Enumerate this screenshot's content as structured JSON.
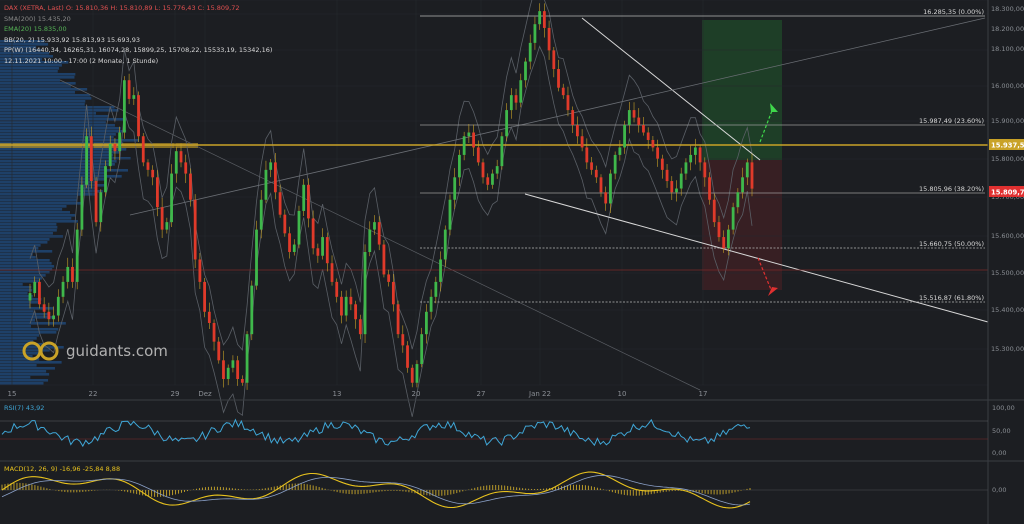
{
  "legend": {
    "title": "DAX (XETRA, Last)",
    "ohlc": "O: 15.810,36  H: 15.810,89  L: 15.776,43  C: 15.809,72",
    "sma200": "SMA(200)  15.435,20",
    "ema": "EMA(20)  15.835,00",
    "bb": "BB(20, 2)  15.933,92  15.813,93  15.693,93",
    "pp": "PP(W)  (16440,34, 16265,31, 16074,28, 15899,25, 15708,22, 15533,19, 15342,16)",
    "range": "12.11.2021 10:00 - 17:00  (2 Monate, 1 Stunde)"
  },
  "logo_text": "guidants.com",
  "rsi_label": "RSI(7)  43,92",
  "macd_label": "MACD(12, 26, 9)  -16,96  -25,84  8,88",
  "chart_data": {
    "type": "line",
    "title": "DAX (XETRA, Last)",
    "y_ticks": [
      "18.300,00",
      "18.200,00",
      "18.100,00",
      "16.000,00",
      "15.900,00",
      "15.800,00",
      "15.700,00",
      "15.600,00",
      "15.500,00",
      "15.400,00",
      "15.300,00"
    ],
    "x_ticks": [
      "15",
      "22",
      "29",
      "Dez",
      "13",
      "20",
      "27",
      "Jan 22",
      "10",
      "17"
    ],
    "fibonacci": [
      {
        "price": 16285.35,
        "label": "16.285,35 (0.00%)"
      },
      {
        "price": 15987.49,
        "label": "15.987,49 (23.60%)"
      },
      {
        "price": 15805.96,
        "label": "15.805,96 (38.20%)"
      },
      {
        "price": 15660.75,
        "label": "15.660,75 (50.00%)"
      },
      {
        "price": 15516.87,
        "label": "15.516,87 (61.80%)"
      }
    ],
    "price_tags": [
      {
        "price": 15937.5,
        "label": "15.937,50",
        "color": "#c9a227"
      },
      {
        "price": 15809.72,
        "label": "15.809,72",
        "color": "#e03030"
      }
    ],
    "ylim": [
      15270,
      16300
    ],
    "close_path": [
      15530,
      15560,
      15500,
      15480,
      15460,
      15470,
      15520,
      15560,
      15600,
      15560,
      15700,
      15820,
      15950,
      15830,
      15720,
      15800,
      15870,
      15930,
      15910,
      15960,
      16100,
      16050,
      16060,
      15950,
      15880,
      15860,
      15840,
      15760,
      15700,
      15720,
      15850,
      15910,
      15880,
      15850,
      15780,
      15620,
      15560,
      15480,
      15450,
      15400,
      15350,
      15300,
      15330,
      15350,
      15300,
      15290,
      15420,
      15550,
      15700,
      15780,
      15860,
      15880,
      15800,
      15740,
      15690,
      15640,
      15660,
      15750,
      15820,
      15730,
      15650,
      15630,
      15680,
      15610,
      15560,
      15520,
      15470,
      15520,
      15500,
      15460,
      15420,
      15640,
      15700,
      15720,
      15660,
      15580,
      15560,
      15500,
      15420,
      15390,
      15330,
      15290,
      15340,
      15420,
      15480,
      15520,
      15560,
      15620,
      15700,
      15780,
      15840,
      15900,
      15950,
      15960,
      15920,
      15880,
      15840,
      15820,
      15850,
      15870,
      15950,
      16020,
      16060,
      16040,
      16100,
      16150,
      16200,
      16250,
      16285,
      16240,
      16180,
      16130,
      16080,
      16060,
      16020,
      15980,
      15950,
      15920,
      15880,
      15860,
      15840,
      15800,
      15770,
      15850,
      15900,
      15920,
      15980,
      16020,
      16000,
      15980,
      15960,
      15940,
      15920,
      15890,
      15860,
      15830,
      15800,
      15810,
      15850,
      15880,
      15900,
      15920,
      15880,
      15840,
      15780,
      15720,
      15680,
      15650,
      15700,
      15760,
      15800,
      15840,
      15880,
      15809.72
    ],
    "rsi": {
      "ylim": [
        0,
        100
      ],
      "ticks": [
        "100,00",
        "50,00",
        "0,00"
      ],
      "levels": [
        70,
        30
      ]
    },
    "macd": {
      "ticks": [
        "0,00"
      ]
    }
  }
}
